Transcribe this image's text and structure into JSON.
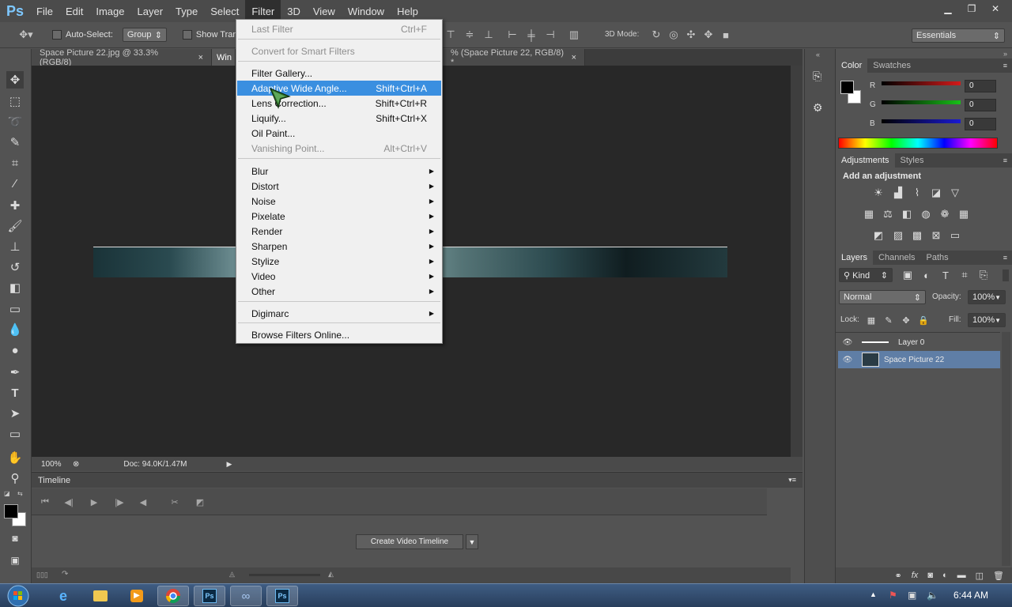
{
  "app": {
    "logo": "Ps"
  },
  "menubar": {
    "items": [
      "File",
      "Edit",
      "Image",
      "Layer",
      "Type",
      "Select",
      "Filter",
      "3D",
      "View",
      "Window",
      "Help"
    ],
    "active": "Filter"
  },
  "options": {
    "auto_select": "Auto-Select:",
    "group": "Group",
    "show_transform": "Show Tran",
    "mode_3d": "3D Mode:",
    "workspace": "Essentials"
  },
  "tabs": [
    {
      "label": "Space Picture 22.jpg @ 33.3% (RGB/8)",
      "close": "×"
    },
    {
      "label": "Win",
      "close": ""
    },
    {
      "label": "% (Space Picture 22, RGB/8) *",
      "close": "×"
    }
  ],
  "status": {
    "zoom": "100%",
    "doc": "Doc: 94.0K/1.47M"
  },
  "timeline": {
    "title": "Timeline",
    "create_button": "Create Video Timeline"
  },
  "filter_menu": [
    {
      "label": "Last Filter",
      "shortcut": "Ctrl+F",
      "disabled": true
    },
    {
      "label": "Convert for Smart Filters",
      "shortcut": "",
      "disabled": true
    },
    {
      "label": "Filter Gallery...",
      "shortcut": ""
    },
    {
      "label": "Adaptive Wide Angle...",
      "shortcut": "Shift+Ctrl+A",
      "highlight": true
    },
    {
      "label": "Lens Correction...",
      "shortcut": "Shift+Ctrl+R"
    },
    {
      "label": "Liquify...",
      "shortcut": "Shift+Ctrl+X"
    },
    {
      "label": "Oil Paint...",
      "shortcut": ""
    },
    {
      "label": "Vanishing Point...",
      "shortcut": "Alt+Ctrl+V",
      "disabled": true
    },
    {
      "label": "Blur",
      "sub": true
    },
    {
      "label": "Distort",
      "sub": true
    },
    {
      "label": "Noise",
      "sub": true
    },
    {
      "label": "Pixelate",
      "sub": true
    },
    {
      "label": "Render",
      "sub": true
    },
    {
      "label": "Sharpen",
      "sub": true
    },
    {
      "label": "Stylize",
      "sub": true
    },
    {
      "label": "Video",
      "sub": true
    },
    {
      "label": "Other",
      "sub": true
    },
    {
      "label": "Digimarc",
      "sub": true
    },
    {
      "label": "Browse Filters Online...",
      "shortcut": ""
    }
  ],
  "color_panel": {
    "tabs": [
      "Color",
      "Swatches"
    ],
    "channels": [
      {
        "label": "R",
        "value": "0",
        "color": "#d41a1a"
      },
      {
        "label": "G",
        "value": "0",
        "color": "#18c018"
      },
      {
        "label": "B",
        "value": "0",
        "color": "#1a1ad4"
      }
    ]
  },
  "adjustments": {
    "tabs": [
      "Adjustments",
      "Styles"
    ],
    "heading": "Add an adjustment"
  },
  "layers": {
    "tabs": [
      "Layers",
      "Channels",
      "Paths"
    ],
    "kind": "Kind",
    "blend": "Normal",
    "opacity_label": "Opacity:",
    "opacity": "100%",
    "lock_label": "Lock:",
    "fill_label": "Fill:",
    "fill": "100%",
    "items": [
      {
        "name": "Layer 0",
        "selected": false
      },
      {
        "name": "Space Picture 22",
        "selected": true
      }
    ]
  },
  "taskbar": {
    "time": "6:44 AM"
  }
}
